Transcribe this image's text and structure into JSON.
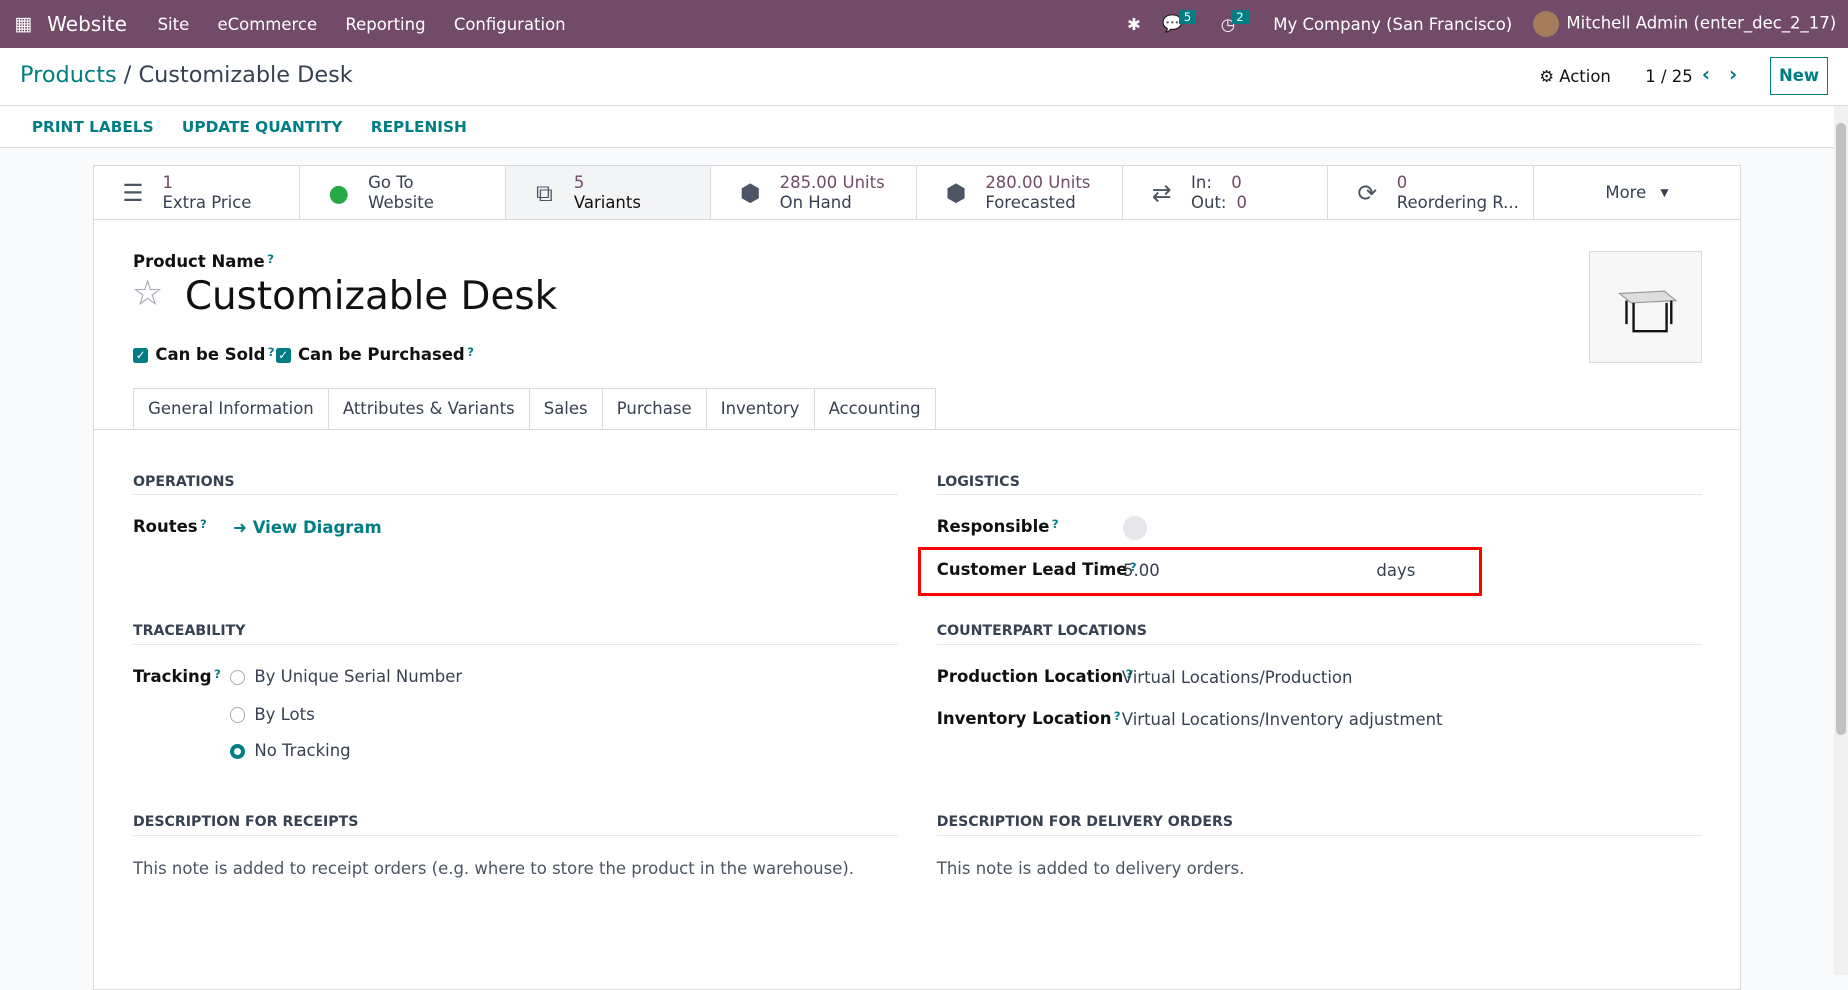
{
  "navbar": {
    "app": "Website",
    "menus": [
      "Site",
      "eCommerce",
      "Reporting",
      "Configuration"
    ],
    "messages_count": "5",
    "activities_count": "2",
    "company": "My Company (San Francisco)",
    "user": "Mitchell Admin (enter_dec_2_17)"
  },
  "control": {
    "breadcrumb_root": "Products",
    "separator": "/",
    "breadcrumb_current": "Customizable Desk",
    "action": "Action",
    "pager": "1 / 25",
    "new": "New"
  },
  "toolbar": [
    "PRINT LABELS",
    "UPDATE QUANTITY",
    "REPLENISH"
  ],
  "stats": [
    {
      "icon": "list-icon",
      "value": "1",
      "label": "Extra Price"
    },
    {
      "icon": "globe-icon",
      "value": "Go To",
      "label": "Website"
    },
    {
      "icon": "sitemap-icon",
      "value": "5",
      "label": "Variants"
    },
    {
      "icon": "cubes-icon",
      "value": "285.00 Units",
      "label": "On Hand"
    },
    {
      "icon": "cubes-icon",
      "value": "280.00 Units",
      "label": "Forecasted"
    },
    {
      "icon": "exchange-icon",
      "in_label": "In:",
      "in_value": "0",
      "out_label": "Out:",
      "out_value": "0"
    },
    {
      "icon": "refresh-icon",
      "value": "0",
      "label": "Reordering R..."
    }
  ],
  "more": "More",
  "product": {
    "name_label": "Product Name",
    "name": "Customizable Desk",
    "can_be_sold": "Can be Sold",
    "can_be_purchased": "Can be Purchased"
  },
  "tabs": [
    "General Information",
    "Attributes & Variants",
    "Sales",
    "Purchase",
    "Inventory",
    "Accounting"
  ],
  "operations": {
    "title": "OPERATIONS",
    "routes_label": "Routes",
    "view_diagram": "View Diagram"
  },
  "logistics": {
    "title": "LOGISTICS",
    "responsible_label": "Responsible",
    "lead_time_label": "Customer Lead Time",
    "lead_time_value": "5.00",
    "lead_time_unit": "days"
  },
  "traceability": {
    "title": "TRACEABILITY",
    "tracking_label": "Tracking",
    "options": [
      "By Unique Serial Number",
      "By Lots",
      "No Tracking"
    ],
    "selected": "No Tracking"
  },
  "counterpart": {
    "title": "COUNTERPART LOCATIONS",
    "production_label": "Production Location",
    "production_value": "Virtual Locations/Production",
    "inventory_label": "Inventory Location",
    "inventory_value": "Virtual Locations/Inventory adjustment"
  },
  "receipts": {
    "title": "DESCRIPTION FOR RECEIPTS",
    "placeholder": "This note is added to receipt orders (e.g. where to store the product in the warehouse)."
  },
  "delivery": {
    "title": "DESCRIPTION FOR DELIVERY ORDERS",
    "placeholder": "This note is added to delivery orders."
  },
  "colors": {
    "brand": "#714b67",
    "accent": "#017e84",
    "highlight": "#ff0000"
  }
}
